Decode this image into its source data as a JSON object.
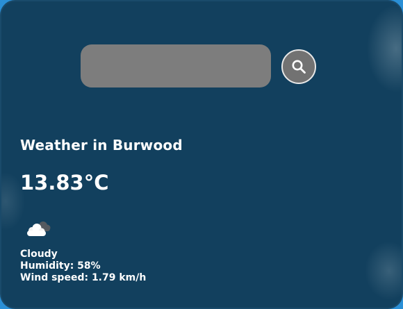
{
  "search": {
    "placeholder": "",
    "value": "",
    "button_icon": "search-icon"
  },
  "weather": {
    "city_title": "Weather in Burwood",
    "temperature": "13.83°C",
    "condition_icon": "cloudy-icon",
    "description": "Cloudy",
    "humidity": "Humidity: 58%",
    "wind": "Wind speed: 1.79 km/h"
  },
  "colors": {
    "card_background": "#12405e",
    "page_accent": "#2a8fd6",
    "search_field": "#7d7d7d",
    "search_button": "#727272",
    "text": "#ffffff"
  }
}
